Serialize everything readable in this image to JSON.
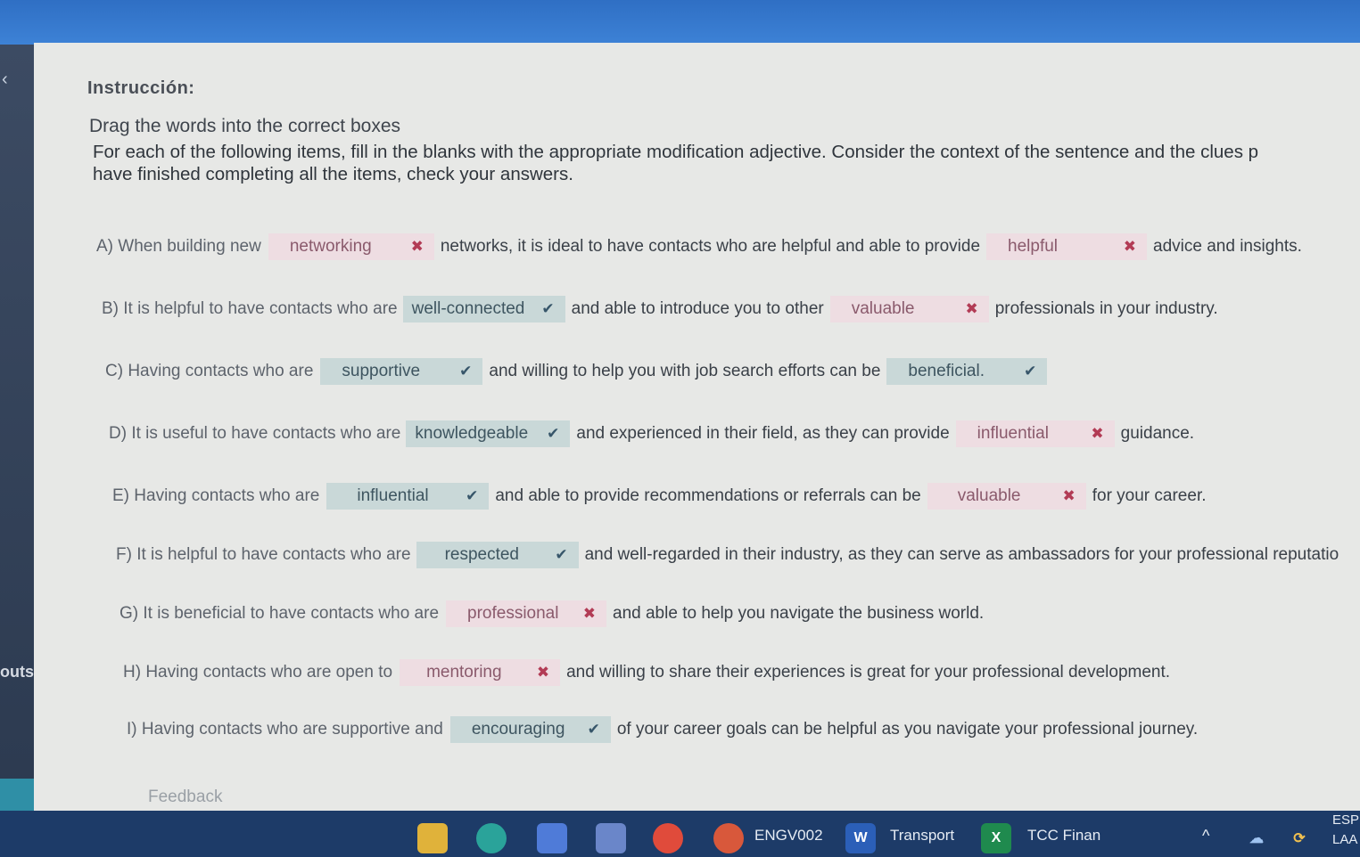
{
  "instruction_heading": "Instrucción:",
  "subtitle": "Drag the words into the correct boxes",
  "paragraph_line1": "For each of the following items, fill in the blanks with the appropriate modification adjective. Consider the context of the sentence and the clues p",
  "paragraph_line2": "have finished completing all the items, check your answers.",
  "items": [
    {
      "lead": "A) When building new",
      "blank1": {
        "word": "networking",
        "status": "incorrect"
      },
      "mid": "networks, it is ideal to have contacts who are helpful and able to provide",
      "blank2": {
        "word": "helpful",
        "status": "incorrect"
      },
      "tail": "advice and insights."
    },
    {
      "lead": "B) It is helpful to have contacts who are",
      "blank1": {
        "word": "well-connected",
        "status": "correct"
      },
      "mid": "and able to introduce you to other",
      "blank2": {
        "word": "valuable",
        "status": "incorrect"
      },
      "tail": "professionals in your industry."
    },
    {
      "lead": "C) Having contacts who are",
      "blank1": {
        "word": "supportive",
        "status": "correct"
      },
      "mid": "and willing to help you with job search efforts can be",
      "blank2": {
        "word": "beneficial.",
        "status": "correct"
      },
      "tail": ""
    },
    {
      "lead": "D) It is useful to have contacts who are",
      "blank1": {
        "word": "knowledgeable",
        "status": "correct"
      },
      "mid": "and experienced in their field, as they can provide",
      "blank2": {
        "word": "influential",
        "status": "incorrect"
      },
      "tail": "guidance."
    },
    {
      "lead": "E) Having contacts who are",
      "blank1": {
        "word": "influential",
        "status": "correct"
      },
      "mid": "and able to provide recommendations or referrals can be",
      "blank2": {
        "word": "valuable",
        "status": "incorrect"
      },
      "tail": "for your career."
    },
    {
      "lead": "F) It is helpful to have contacts who are",
      "blank1": {
        "word": "respected",
        "status": "correct"
      },
      "mid": "and well-regarded in their industry, as they can serve as ambassadors for your professional reputatio"
    },
    {
      "lead": "G) It is beneficial to have contacts who are",
      "blank1": {
        "word": "professional",
        "status": "incorrect"
      },
      "mid": "and able to help you navigate the business world."
    },
    {
      "lead": "H) Having contacts who are open to",
      "blank1": {
        "word": "mentoring",
        "status": "incorrect"
      },
      "mid": "and willing to share their experiences is great for your professional development."
    },
    {
      "lead": "I) Having contacts who are supportive and",
      "blank1": {
        "word": "encouraging",
        "status": "correct"
      },
      "mid": "of your career goals can be helpful as you navigate your professional journey."
    }
  ],
  "feedback_label": "Feedback",
  "sidebar": {
    "outs_label": "outs"
  },
  "taskbar": {
    "app1": "ENGV002",
    "app2": "Transport",
    "app3": "TCC Finan",
    "lang1": "ESP",
    "lang2": "LAA"
  },
  "colors": {
    "correct_bg": "#c9d8d8",
    "incorrect_bg": "#eedde2",
    "incorrect_mark": "#b23b55"
  },
  "icons": {
    "correct": "checkmark-icon",
    "incorrect": "x-mark-icon"
  }
}
